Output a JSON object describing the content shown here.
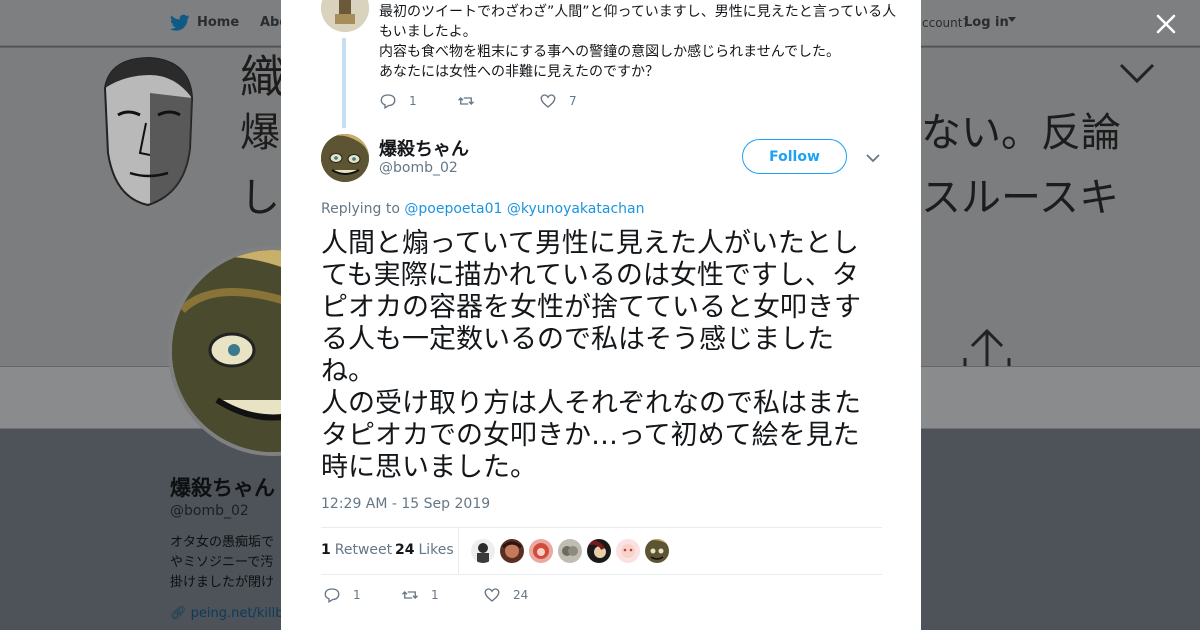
{
  "background": {
    "nav": {
      "home_label": "Home",
      "about_label": "Abo",
      "account_prompt": "ccount?",
      "login_label": "Log in"
    },
    "banner": {
      "line1": "織",
      "line2": "爆",
      "line3": "し",
      "right1": "ない。反論",
      "right2": "スルースキ"
    },
    "profile": {
      "name": "爆殺ちゃん",
      "handle": "@bomb_02",
      "bio": [
        "オタ女の愚痴垢で",
        "やミソジニーで汚",
        "掛けましたが閉け"
      ],
      "link": "peing.net/killbo"
    }
  },
  "previous_tweet": {
    "lines": [
      "最初のツイートでわざわざ”人間”と仰っていますし、男性に見えたと言っている人もいましたよ。",
      "内容も食べ物を粗末にする事への警鐘の意図しか感じられませんでした。",
      "あなたには女性への非難に見えたのですか？"
    ],
    "reply_count": "1",
    "retweet_count": "",
    "like_count": "7"
  },
  "tweet": {
    "author_name": "爆殺ちゃん",
    "author_handle": "@bomb_02",
    "follow_label": "Follow",
    "replying_prefix": "Replying to",
    "replying_to": [
      "@poepoeta01",
      "@kyunoyakatachan"
    ],
    "text_paragraphs": [
      "人間と煽っていて男性に見えた人がいたとしても実際に描かれているのは女性ですし、タピオカの容器を女性が捨てていると女叩きする人も一定数いるので私はそう感じましたね。",
      "人の受け取り方は人それぞれなので私はまたタピオカでの女叩きか…って初めて絵を見た時に思いました。"
    ],
    "timestamp": "12:29 AM - 15 Sep 2019",
    "retweets_count": "1",
    "retweets_label": "Retweet",
    "likes_count": "24",
    "likes_label": "Likes",
    "reply_count": "1",
    "retweet_action_count": "1",
    "like_action_count": "24"
  },
  "colors": {
    "accent": "#1da1f2",
    "link": "#1b95e0",
    "muted": "#657786",
    "thread_line": "#c4def2"
  },
  "likers": [
    "liker-1",
    "liker-2",
    "liker-3",
    "liker-4",
    "liker-5",
    "liker-6",
    "liker-7"
  ]
}
